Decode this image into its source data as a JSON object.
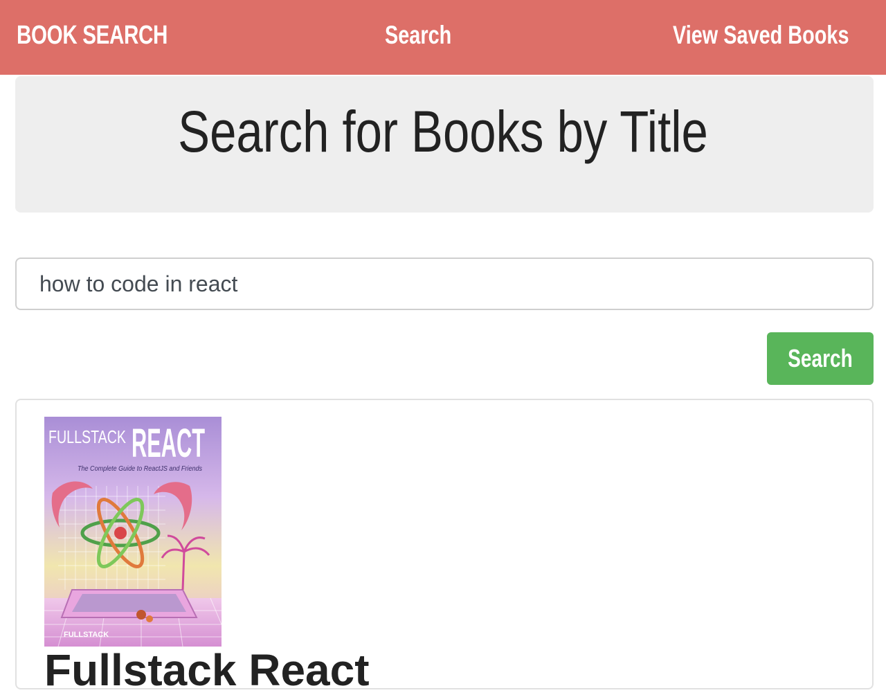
{
  "navbar": {
    "brand": "BOOK SEARCH",
    "links": [
      {
        "label": "Search"
      },
      {
        "label": "View Saved Books"
      }
    ]
  },
  "jumbotron": {
    "title": "Search for Books by Title"
  },
  "search": {
    "value": "how to code in react",
    "button_label": "Search"
  },
  "results": [
    {
      "title": "Fullstack React",
      "cover": {
        "brand_text": "FULLSTACK",
        "title_text": "REACT",
        "subtitle_text": "The Complete Guide to ReactJS and Friends",
        "publisher_text": "FULLSTACK"
      }
    }
  ],
  "colors": {
    "navbar": "#dd6f68",
    "jumbotron": "#eeeeee",
    "button": "#59b55a"
  }
}
